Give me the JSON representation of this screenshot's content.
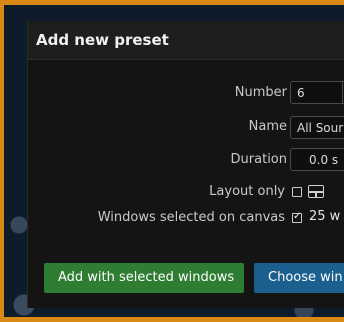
{
  "dialog": {
    "title": "Add new preset",
    "number_label": "Number",
    "number_value": "6",
    "name_label": "Name",
    "name_value": "All Sour",
    "duration_label": "Duration",
    "duration_value": "0.0 s",
    "layout_only_label": "Layout only",
    "layout_only_checked": false,
    "windows_selected_label": "Windows selected on canvas",
    "windows_selected_checked": true,
    "windows_selected_count": "25 w",
    "add_button_label": "Add with selected windows",
    "choose_button_label": "Choose win"
  },
  "colors": {
    "accent_frame": "#d98a14",
    "add_button": "#2e7d32",
    "choose_button": "#1b5f8e"
  }
}
